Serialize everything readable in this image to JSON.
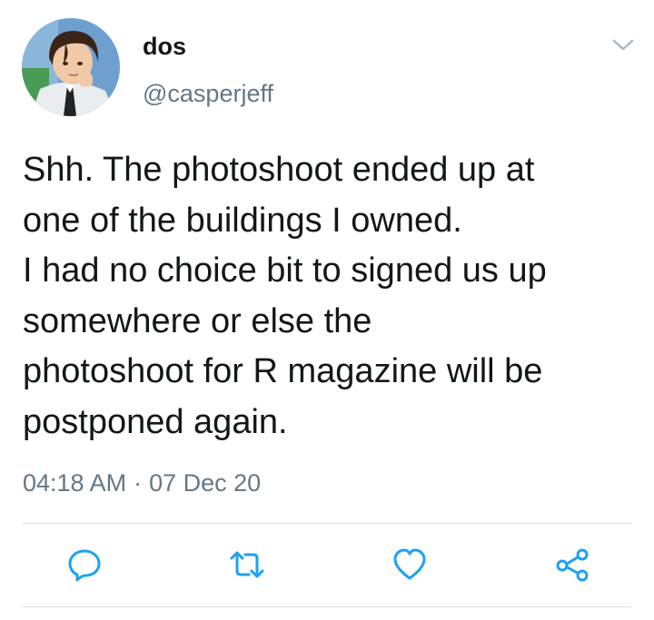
{
  "user": {
    "display_name": "dos",
    "handle": "@casperjeff",
    "avatar_icon": "anime-character-avatar"
  },
  "tweet": {
    "text": "Shh. The photoshoot ended up at\none of the buildings I owned.\nI had no choice bit to signed us up\nsomewhere or else the\nphotoshoot for R magazine will be\npostponed again.",
    "time": "04:18 AM",
    "separator": "·",
    "date": "07 Dec 20"
  },
  "actions": [
    {
      "icon": "reply-icon"
    },
    {
      "icon": "retweet-icon"
    },
    {
      "icon": "like-icon"
    },
    {
      "icon": "share-icon"
    }
  ],
  "colors": {
    "text": "#14171a",
    "secondary": "#657786",
    "icon": "#1da1f2",
    "divider": "#d9dee3"
  }
}
